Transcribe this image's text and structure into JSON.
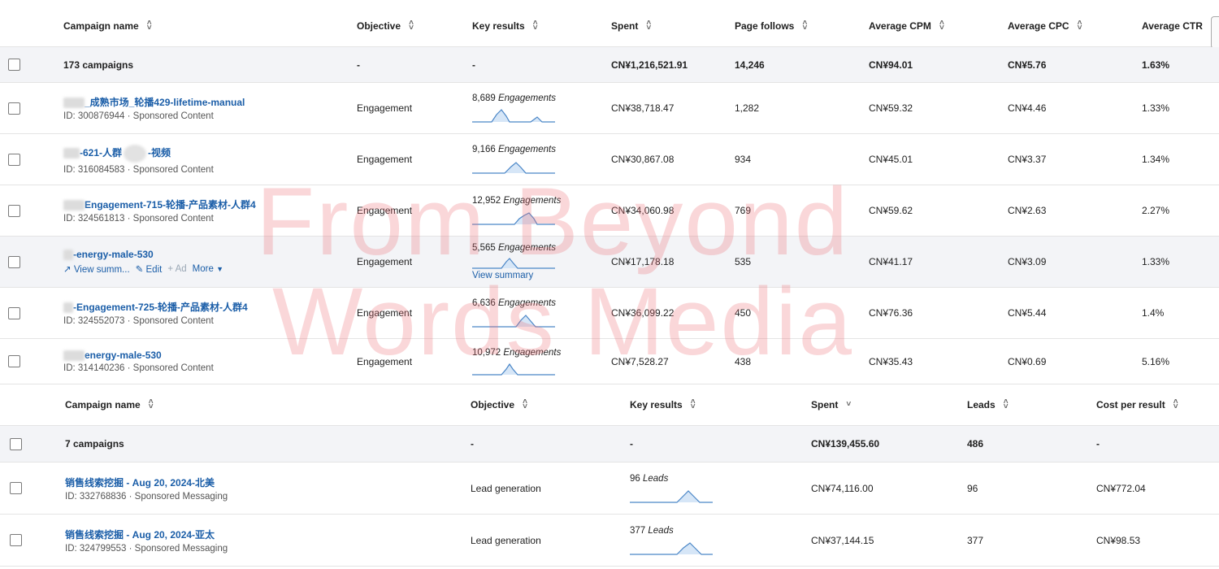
{
  "table1": {
    "headers": [
      "Campaign name",
      "Objective",
      "Key results",
      "Spent",
      "Page follows",
      "Average CPM",
      "Average CPC",
      "Average CTR"
    ],
    "total": {
      "label": "173 campaigns",
      "objective": "-",
      "key_results": "-",
      "spent": "CN¥1,216,521.91",
      "page_follows": "14,246",
      "cpm": "CN¥94.01",
      "cpc": "CN¥5.76",
      "ctr": "1.63%"
    },
    "rows": [
      {
        "name": "_成熟市场_轮播429-lifetime-manual",
        "meta": "ID: 300876944 · Sponsored Content",
        "objective": "Engagement",
        "kr_value": "8,689",
        "kr_unit": "Engagements",
        "spent": "CN¥38,718.47",
        "page_follows": "1,282",
        "cpm": "CN¥59.32",
        "cpc": "CN¥4.46",
        "ctr": "1.33%"
      },
      {
        "name_a": "-621-人群",
        "name_b": "-视频",
        "meta": "ID: 316084583 · Sponsored Content",
        "objective": "Engagement",
        "kr_value": "9,166",
        "kr_unit": "Engagements",
        "spent": "CN¥30,867.08",
        "page_follows": "934",
        "cpm": "CN¥45.01",
        "cpc": "CN¥3.37",
        "ctr": "1.34%"
      },
      {
        "name": "Engagement-715-轮播-产品素材-人群4",
        "meta": "ID: 324561813 · Sponsored Content",
        "objective": "Engagement",
        "kr_value": "12,952",
        "kr_unit": "Engagements",
        "spent": "CN¥34,060.98",
        "page_follows": "769",
        "cpm": "CN¥59.62",
        "cpc": "CN¥2.63",
        "ctr": "2.27%"
      },
      {
        "name": "-energy-male-530",
        "objective": "Engagement",
        "kr_value": "5,565",
        "kr_unit": "Engagements",
        "view_summary": "View summary",
        "actions": {
          "view": "View summ...",
          "edit": "Edit",
          "ad": "+ Ad",
          "more": "More"
        },
        "spent": "CN¥17,178.18",
        "page_follows": "535",
        "cpm": "CN¥41.17",
        "cpc": "CN¥3.09",
        "ctr": "1.33%"
      },
      {
        "name": "-Engagement-725-轮播-产品素材-人群4",
        "meta": "ID: 324552073 · Sponsored Content",
        "objective": "Engagement",
        "kr_value": "6,636",
        "kr_unit": "Engagements",
        "spent": "CN¥36,099.22",
        "page_follows": "450",
        "cpm": "CN¥76.36",
        "cpc": "CN¥5.44",
        "ctr": "1.4%"
      },
      {
        "name": "energy-male-530",
        "meta": "ID: 314140236 · Sponsored Content",
        "objective": "Engagement",
        "kr_value": "10,972",
        "kr_unit": "Engagements",
        "spent": "CN¥7,528.27",
        "page_follows": "438",
        "cpm": "CN¥35.43",
        "cpc": "CN¥0.69",
        "ctr": "5.16%"
      }
    ]
  },
  "table2": {
    "headers": [
      "Campaign name",
      "Objective",
      "Key results",
      "Spent",
      "Leads",
      "Cost per result"
    ],
    "total": {
      "label": "7 campaigns",
      "objective": "-",
      "key_results": "-",
      "spent": "CN¥139,455.60",
      "leads": "486",
      "cost": "-"
    },
    "rows": [
      {
        "name": "销售线索挖掘 - Aug 20, 2024-北美",
        "meta": "ID: 332768836 · Sponsored Messaging",
        "objective": "Lead generation",
        "kr_value": "96",
        "kr_unit": "Leads",
        "spent": "CN¥74,116.00",
        "leads": "96",
        "cost": "CN¥772.04"
      },
      {
        "name": "销售线索挖掘 - Aug 20, 2024-亚太",
        "meta": "ID: 324799553 · Sponsored Messaging",
        "objective": "Lead generation",
        "kr_value": "377",
        "kr_unit": "Leads",
        "spent": "CN¥37,144.15",
        "leads": "377",
        "cost": "CN¥98.53"
      }
    ]
  },
  "watermark": {
    "line1": "From Beyond",
    "line2": "Words Media"
  },
  "colors": {
    "link": "#1b5ea8",
    "spark": "#4a86c7",
    "spark_fill": "#d6e6f7",
    "row_alt": "#f3f4f7",
    "watermark": "#ec6e78"
  }
}
